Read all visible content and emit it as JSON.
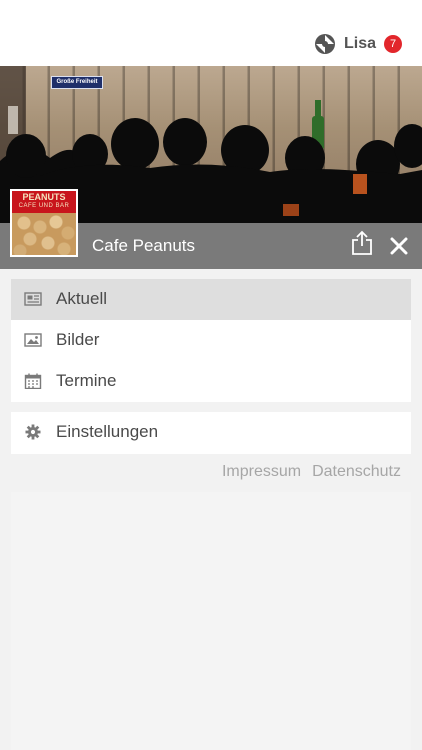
{
  "header": {
    "user_name": "Lisa",
    "notification_count": "7"
  },
  "hero": {
    "street_sign": "Große Freiheit"
  },
  "venue": {
    "name": "Cafe Peanuts",
    "logo_title": "PEANUTS",
    "logo_subtitle": "CAFE UND BAR"
  },
  "menu": {
    "items": [
      {
        "label": "Aktuell",
        "icon": "newspaper-icon",
        "active": true
      },
      {
        "label": "Bilder",
        "icon": "image-icon",
        "active": false
      },
      {
        "label": "Termine",
        "icon": "calendar-icon",
        "active": false
      }
    ],
    "settings": {
      "label": "Einstellungen",
      "icon": "gear-icon"
    }
  },
  "footer": {
    "impressum": "Impressum",
    "datenschutz": "Datenschutz"
  },
  "colors": {
    "badge": "#e2262b",
    "title_bar": "#7a7a7a",
    "active_item": "#dedede"
  }
}
